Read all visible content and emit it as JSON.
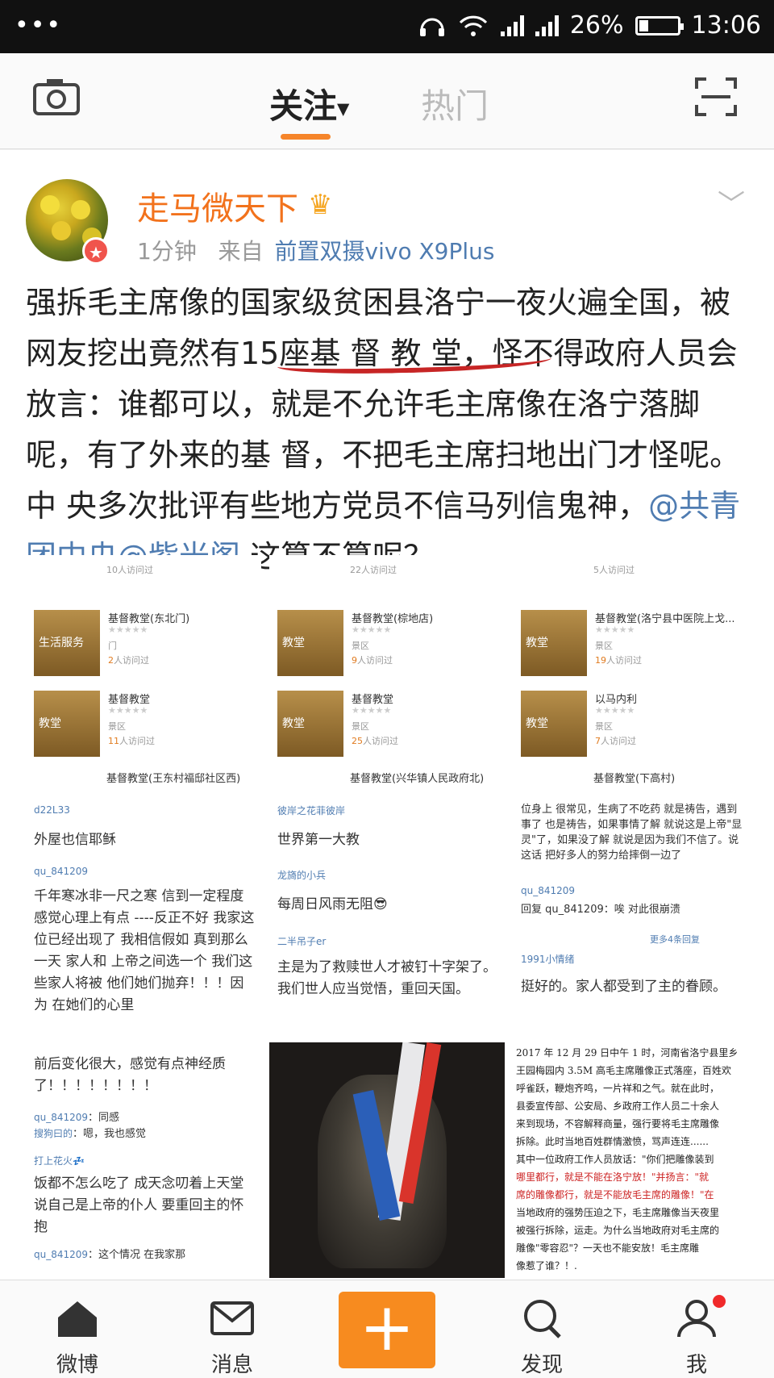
{
  "status_bar": {
    "dots": "•••",
    "battery": "26%",
    "battery_level": 0.26,
    "time": "13:06"
  },
  "top_nav": {
    "tab_follow": "关注",
    "tab_hot": "热门"
  },
  "post": {
    "username": "走马微天下",
    "time": "1分钟",
    "from_label": "来自",
    "source": "前置双摄vivo X9Plus",
    "text_main": "强拆毛主席像的国家级贫困县洛宁一夜火遍全国，被网友挖出竟然有15座基 督 教 堂，怪不得政府人员会放言：谁都可以，就是不允许毛主席像在洛宁落脚呢，有了外来的基 督，不把毛主席扫地出门才怪呢。中 央多次批评有些地方党员不信马列信鬼神，",
    "mention1": "@共青团中央",
    "mention2": "@紫光阁",
    "text_tail": " 这算不算呢？"
  },
  "images": {
    "map_cards": [
      {
        "title": "基督教堂(东北门)",
        "thumb": "生活服务",
        "sub": "门",
        "visits": "2",
        "visits_suffix": "人访问过"
      },
      {
        "title": "基督教堂(棕地店)",
        "thumb": "教堂",
        "sub": "景区",
        "visits": "9",
        "visits_suffix": "人访问过"
      },
      {
        "title": "基督教堂(洛宁县中医院上戈...",
        "thumb": "教堂",
        "sub": "景区",
        "visits": "19",
        "visits_suffix": "人访问过"
      },
      {
        "title": "基督教堂",
        "thumb": "教堂",
        "sub": "景区",
        "visits": "11",
        "visits_suffix": "人访问过"
      },
      {
        "title": "基督教堂",
        "thumb": "教堂",
        "sub": "景区",
        "visits": "25",
        "visits_suffix": "人访问过"
      },
      {
        "title": "以马内利",
        "thumb": "教堂",
        "sub": "景区",
        "visits": "7",
        "visits_suffix": "人访问过"
      }
    ],
    "map_top_visits": [
      "10人访问过",
      "22人访问过",
      "5人访问过"
    ],
    "map_bottom_titles": [
      "基督教堂(王东村福邸社区西)",
      "基督教堂(兴华镇人民政府北)",
      "基督教堂(下高村)"
    ],
    "comments_left": {
      "u1": "d22L33",
      "c1": "外屋也信耶稣",
      "u2": "qu_841209",
      "c2": "千年寒冰非一尺之寒 信到一定程度 感觉心理上有点 ----反正不好 我家这位已经出现了 我相信假如 真到那么一天 家人和 上帝之间选一个 我们这些家人将被 他们她们抛弃！！！因为 在她们的心里"
    },
    "comments_mid": {
      "u1": "彼岸之花菲彼岸",
      "c1": "世界第一大教",
      "u2": "龙旖的小兵",
      "c2": "每周日风雨无阻😎",
      "u3": "二半吊子er",
      "c3": "主是为了救赎世人才被钉十字架了。我们世人应当觉悟，重回天国。"
    },
    "comments_right": {
      "c1": "位身上 很常见，生病了不吃药 就是祷告，遇到事了 也是祷告，如果事情了解 就说这是上帝\"显灵\"了，如果没了解 就说是因为我们不信了。说这话 把好多人的努力给摔倒一边了",
      "u2": "qu_841209",
      "c2": "回复 qu_841209：唉 对此很崩溃",
      "more": "更多4条回复",
      "u3": "1991小情绪",
      "c3": "挺好的。家人都受到了主的眷顾。"
    },
    "comments_bottom_left": {
      "c1": "前后变化很大，感觉有点神经质了！！！！！！！！",
      "u2": "qu_841209",
      "c2": "同感",
      "u3": "搜狗曰的",
      "c3": "嗯，我也感觉",
      "u4": "打上花火💤",
      "c4": "饭都不怎么吃了 成天念叨着上天堂 说自己是上帝的仆人 要重回主的怀抱",
      "u5": "qu_841209",
      "c5": "这个情况 在我家那"
    },
    "doc_lines": [
      "2017 年 12 月 29 日中午 1 时，河南省洛宁县里乡",
      "王园梅园内 3.5M 高毛主席雕像正式落座，百姓欢",
      "呼雀跃，鞭炮齐鸣，一片祥和之气。就在此时，",
      "县委宣传部、公安局、乡政府工作人员二十余人",
      "来到现场，不容解释商量，强行要将毛主席雕像",
      "拆除。此时当地百姓群情激愤，骂声连连......",
      "其中一位政府工作人员放话：\"你们把雕像装到",
      "哪里都行，就是不能在洛宁放！\"并扬言：\"就",
      "席的雕像都行，就是不能放毛主席的雕像！\"在",
      "当地政府的强势压迫之下，毛主席雕像当天夜里",
      "被强行拆除，运走。为什么当地政府对毛主席的",
      "雕像\"零容忍\"？一天也不能安放！毛主席雕",
      "像惹了谁？！."
    ]
  },
  "bottom_bar": {
    "weibo": "微博",
    "messages": "消息",
    "compose": "+",
    "discover": "发现",
    "me": "我"
  }
}
